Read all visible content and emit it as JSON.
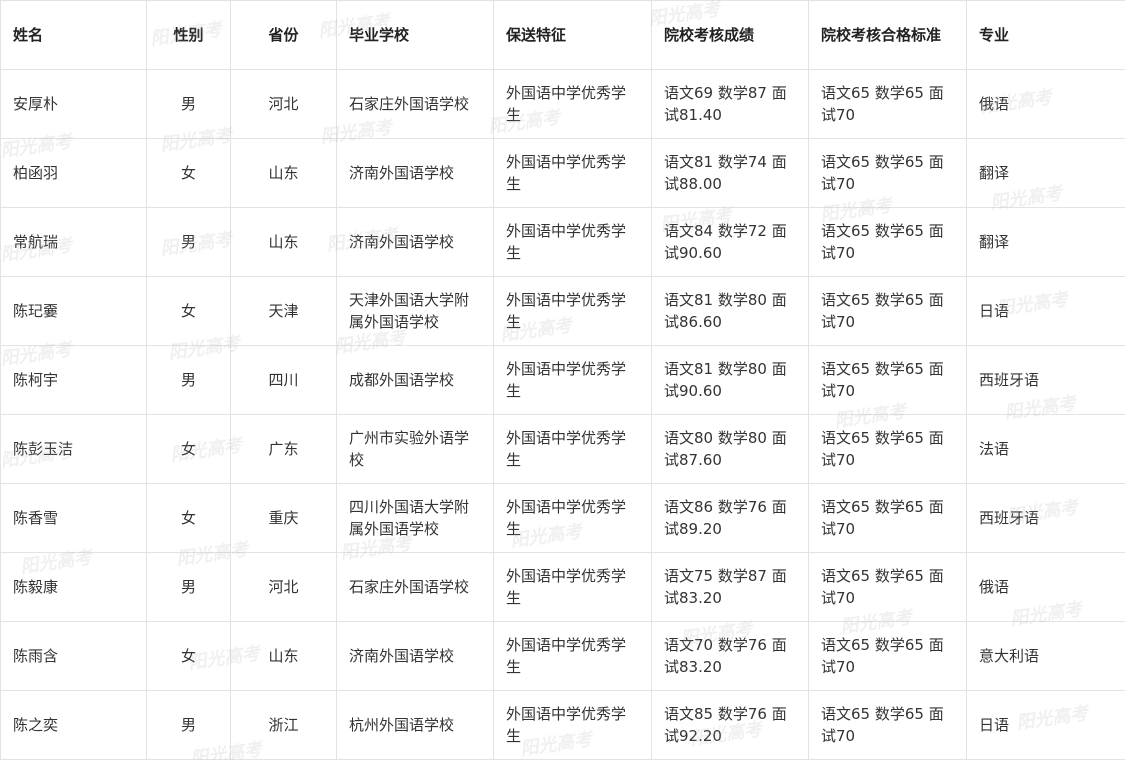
{
  "table": {
    "headers": [
      "姓名",
      "性别",
      "省份",
      "毕业学校",
      "保送特征",
      "院校考核成绩",
      "院校考核合格标准",
      "专业"
    ],
    "rows": [
      [
        "安厚朴",
        "男",
        "河北",
        "石家庄外国语学校",
        "外国语中学优秀学生",
        "语文69 数学87 面试81.40",
        "语文65 数学65 面试70",
        "俄语"
      ],
      [
        "柏函羽",
        "女",
        "山东",
        "济南外国语学校",
        "外国语中学优秀学生",
        "语文81 数学74 面试88.00",
        "语文65 数学65 面试70",
        "翻译"
      ],
      [
        "常航瑞",
        "男",
        "山东",
        "济南外国语学校",
        "外国语中学优秀学生",
        "语文84 数学72 面试90.60",
        "语文65 数学65 面试70",
        "翻译"
      ],
      [
        "陈玘嫑",
        "女",
        "天津",
        "天津外国语大学附属外国语学校",
        "外国语中学优秀学生",
        "语文81 数学80 面试86.60",
        "语文65 数学65 面试70",
        "日语"
      ],
      [
        "陈柯宇",
        "男",
        "四川",
        "成都外国语学校",
        "外国语中学优秀学生",
        "语文81 数学80 面试90.60",
        "语文65 数学65 面试70",
        "西班牙语"
      ],
      [
        "陈彭玉洁",
        "女",
        "广东",
        "广州市实验外语学校",
        "外国语中学优秀学生",
        "语文80 数学80 面试87.60",
        "语文65 数学65 面试70",
        "法语"
      ],
      [
        "陈香雪",
        "女",
        "重庆",
        "四川外国语大学附属外国语学校",
        "外国语中学优秀学生",
        "语文86 数学76 面试89.20",
        "语文65 数学65 面试70",
        "西班牙语"
      ],
      [
        "陈毅康",
        "男",
        "河北",
        "石家庄外国语学校",
        "外国语中学优秀学生",
        "语文75 数学87 面试83.20",
        "语文65 数学65 面试70",
        "俄语"
      ],
      [
        "陈雨含",
        "女",
        "山东",
        "济南外国语学校",
        "外国语中学优秀学生",
        "语文70 数学76 面试83.20",
        "语文65 数学65 面试70",
        "意大利语"
      ],
      [
        "陈之奕",
        "男",
        "浙江",
        "杭州外国语学校",
        "外国语中学优秀学生",
        "语文85 数学76 面试92.20",
        "语文65 数学65 面试70",
        "日语"
      ]
    ]
  },
  "watermark_text": "阳光高考"
}
